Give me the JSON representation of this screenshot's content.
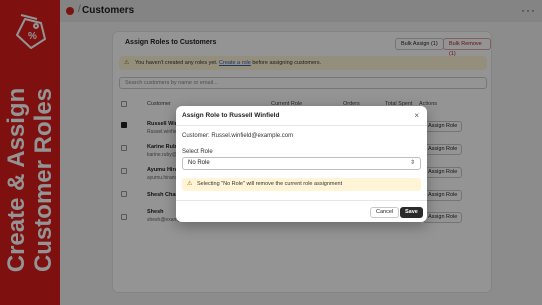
{
  "promo": {
    "line1": "Create & Assign",
    "line2": "Customer Roles"
  },
  "topbar": {
    "separator": "/",
    "title": "Customers",
    "more": "···"
  },
  "card": {
    "title": "Assign Roles to Customers",
    "bulk_assign": "Bulk Assign (1)",
    "bulk_remove": "Bulk Remove (1)",
    "warning_pre": "You haven't created any roles yet.",
    "warning_link": "Create a role",
    "warning_post": "before assigning customers.",
    "search_placeholder": "Search customers by name or email...",
    "columns": {
      "customer": "Customer",
      "current_role": "Current Role",
      "orders": "Orders",
      "total_spent": "Total Spent",
      "actions": "Actions"
    },
    "rows": [
      {
        "name": "Russell Winfield",
        "email": "Russel.winfield@example.com",
        "action": "Assign Role",
        "checked": true
      },
      {
        "name": "Karine Ruby",
        "email": "karine.ruby@example.com",
        "action": "Assign Role",
        "checked": false
      },
      {
        "name": "Ayumu Hirano",
        "email": "ayumu.hirano@example.com",
        "action": "Assign Role",
        "checked": false
      },
      {
        "name": "Shesh Chandra",
        "email": "",
        "action": "Assign Role",
        "checked": false
      },
      {
        "name": "Shesh",
        "email": "shesh@example.com",
        "action": "Assign Role",
        "checked": false
      }
    ]
  },
  "modal": {
    "title": "Assign Role to Russell Winfield",
    "close": "×",
    "customer_line": "Customer: Russel.winfield@example.com",
    "select_label": "Select Role",
    "select_value": "No Role",
    "warning": "Selecting \"No Role\" will remove the current role assignment",
    "cancel": "Cancel",
    "save": "Save"
  },
  "colors": {
    "brand_red": "#d91c1c",
    "save_button": "#2b2b2b",
    "warning_bg": "#fff4d6"
  },
  "icons": {
    "promo": "discount-tag-icon",
    "warning": "warning-triangle-icon",
    "chevron": "chevron-updown-icon",
    "close": "close-icon"
  }
}
